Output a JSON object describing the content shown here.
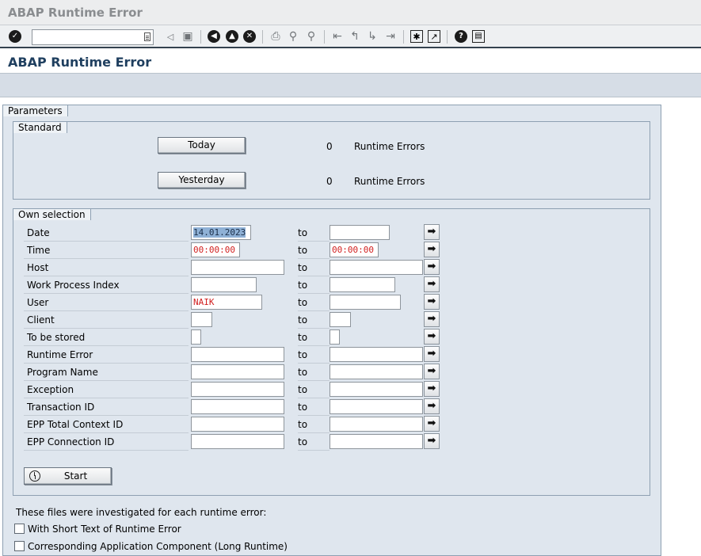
{
  "window": {
    "title": "ABAP Runtime Error"
  },
  "toolbar": {
    "command_field": {
      "value": "",
      "placeholder": ""
    },
    "icons": [
      "enter-icon",
      "back-small-icon",
      "save-icon",
      "back-icon",
      "exit-icon",
      "cancel-icon",
      "print-icon",
      "find-icon",
      "find-next-icon",
      "first-page-icon",
      "previous-page-icon",
      "next-page-icon",
      "last-page-icon",
      "new-session-icon",
      "shortcut-icon",
      "help-icon",
      "customize-layout-icon"
    ]
  },
  "page": {
    "title": "ABAP Runtime Error"
  },
  "parameters": {
    "label": "Parameters",
    "standard": {
      "label": "Standard",
      "today_button": "Today",
      "today_count": "0",
      "today_text": "Runtime Errors",
      "yesterday_button": "Yesterday",
      "yesterday_count": "0",
      "yesterday_text": "Runtime Errors"
    },
    "own_selection": {
      "label": "Own selection",
      "to_label": "to",
      "rows": [
        {
          "label": "Date",
          "from": "14.01.2023",
          "to": ""
        },
        {
          "label": "Time",
          "from": "00:00:00",
          "to": "00:00:00"
        },
        {
          "label": "Host",
          "from": "",
          "to": ""
        },
        {
          "label": "Work Process Index",
          "from": "",
          "to": ""
        },
        {
          "label": "User",
          "from": "NAIK",
          "to": ""
        },
        {
          "label": "Client",
          "from": "",
          "to": ""
        },
        {
          "label": "To be stored",
          "from": "",
          "to": ""
        },
        {
          "label": "Runtime Error",
          "from": "",
          "to": ""
        },
        {
          "label": "Program Name",
          "from": "",
          "to": ""
        },
        {
          "label": "Exception",
          "from": "",
          "to": ""
        },
        {
          "label": "Transaction ID",
          "from": "",
          "to": ""
        },
        {
          "label": "EPP Total Context ID",
          "from": "",
          "to": ""
        },
        {
          "label": "EPP Connection ID",
          "from": "",
          "to": ""
        }
      ],
      "start_button": "Start"
    },
    "files_note": "These files were investigated for each runtime error:",
    "options": [
      {
        "label": "With Short Text of Runtime Error",
        "checked": false
      },
      {
        "label": "Corresponding Application Component (Long Runtime)",
        "checked": false
      }
    ]
  },
  "colors": {
    "header_text": "#1f3f5f",
    "red_value": "#d12020",
    "panel_bg": "#dfe6ee"
  }
}
